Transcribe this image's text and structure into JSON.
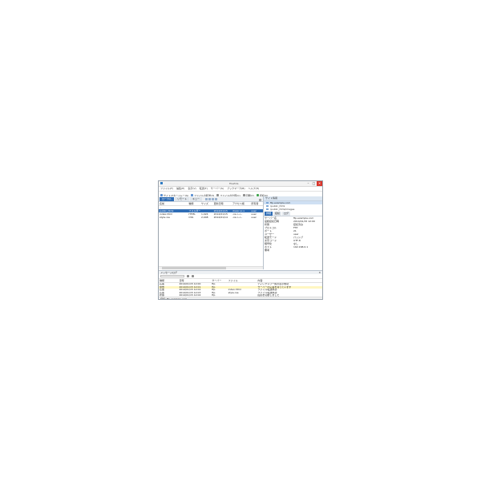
{
  "window": {
    "title": "FileZilla",
    "controls": [
      "–",
      "□",
      "✕"
    ]
  },
  "menu": [
    "ファイル(F)",
    "編集(E)",
    "表示(V)",
    "転送(T)",
    "サーバー(S)",
    "ブックマーク(B)",
    "ヘルプ(H)"
  ],
  "toolbar": {
    "items": [
      {
        "label": "サイトマネージャー(S)",
        "icon": "sitemanager-icon"
      },
      {
        "label": "ファイルの転送(T)",
        "icon": "transfer-icon"
      },
      {
        "label": "ファイルの比較(C)",
        "icon": "compare-icon"
      },
      {
        "label": "同期(Y)",
        "icon": "sync-icon"
      },
      {
        "label": "接続(C)",
        "icon": "connect-icon"
      }
    ]
  },
  "left_tabs": [
    "ローカル",
    "リモート",
    "キュー"
  ],
  "file_table": {
    "columns": [
      "名前",
      "種類",
      "サイズ",
      "更新日時",
      "アクセス権",
      "所有者"
    ],
    "rows": [
      {
        "name": "..",
        "type": "",
        "size": "",
        "date": "",
        "perm": "",
        "owner": ""
      },
      {
        "name": "public_html",
        "type": "フォルダー",
        "size": "",
        "date": "2014/01/15",
        "perm": "drwxr-xr-x",
        "owner": "user"
      },
      {
        "name": "index.html",
        "type": "HTML",
        "size": "1,024",
        "date": "2014/01/15",
        "perm": "-rw-r--r--",
        "owner": "user"
      },
      {
        "name": "style.css",
        "type": "CSS",
        "size": "2,048",
        "date": "2014/01/14",
        "perm": "-rw-r--r--",
        "owner": "user"
      }
    ],
    "selected_row": 1
  },
  "right_panel": {
    "header": "サイト情報",
    "tree": [
      "ftp.example.com",
      "/public_html",
      "/public_html/images"
    ],
    "selected_tree": 0,
    "tabs": [
      "詳細",
      "接続",
      "ログ"
    ],
    "properties": [
      {
        "k": "サーバー名",
        "v": "ftp.example.com"
      },
      {
        "k": "最終接続日時",
        "v": "2014/01/15 12:00"
      },
      {
        "k": "状態",
        "v": "接続済み"
      },
      {
        "k": "プロトコル",
        "v": "FTP"
      },
      {
        "k": "ポート",
        "v": "21"
      },
      {
        "k": "ユーザー",
        "v": "user"
      },
      {
        "k": "転送モード",
        "v": "パッシブ"
      },
      {
        "k": "文字コード",
        "v": "UTF-8"
      },
      {
        "k": "暗号化",
        "v": "なし"
      },
      {
        "k": "ホスト",
        "v": "192.168.0.1"
      },
      {
        "k": "備考",
        "v": ""
      }
    ]
  },
  "log": {
    "title": "メッセージログ",
    "columns": [
      "種類",
      "日時",
      "サーバー",
      "ファイル",
      "内容"
    ],
    "rows": [
      {
        "type": "応答",
        "date": "2014/01/15 12:00",
        "server": "ftp",
        "file": "",
        "msg": "ディレクトリ一覧の表示成功",
        "warn": false
      },
      {
        "type": "警告",
        "date": "2014/01/15 12:01",
        "server": "ftp",
        "file": "",
        "msg": "サーバーの応答を待っています",
        "warn": true
      },
      {
        "type": "応答",
        "date": "2014/01/15 12:02",
        "server": "ftp",
        "file": "index.html",
        "msg": "ファイル転送成功",
        "warn": false
      },
      {
        "type": "応答",
        "date": "2014/01/15 12:03",
        "server": "ftp",
        "file": "style.css",
        "msg": "ファイル転送成功",
        "warn": false
      },
      {
        "type": "状態",
        "date": "2014/01/15 12:04",
        "server": "ftp",
        "file": "",
        "msg": "接続を切断しました",
        "warn": false
      }
    ]
  },
  "status": {
    "text": "接続: ftp.example.com"
  }
}
